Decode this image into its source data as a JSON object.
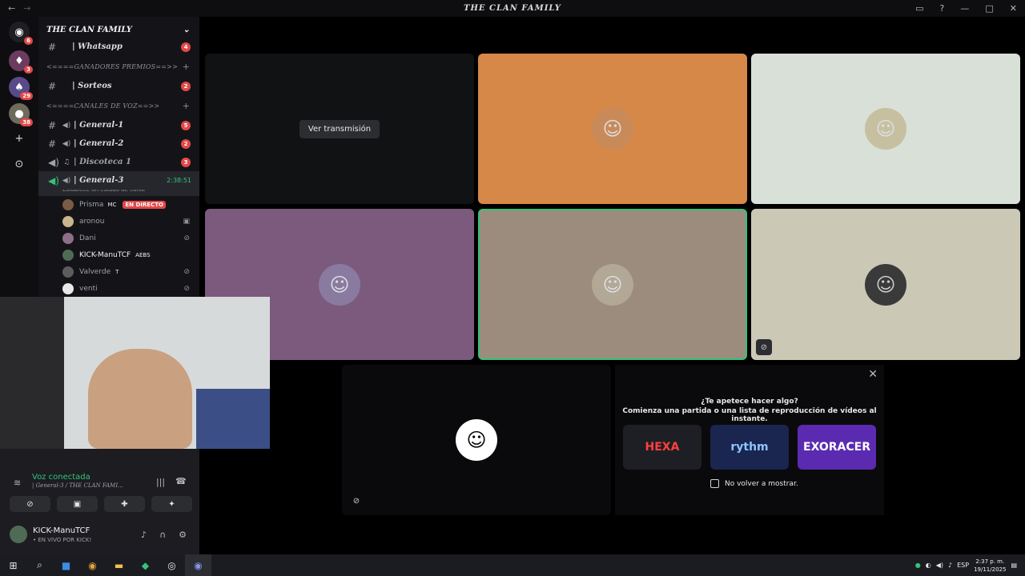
{
  "window": {
    "title": "THE CLAN FAMILY"
  },
  "server": {
    "name": "THE CLAN FAMILY"
  },
  "rail": {
    "dm_badge": "6",
    "s1_badge": "3",
    "s2_badge": "29",
    "s3_badge": "38"
  },
  "channels": [
    {
      "name": "| Whatsapp",
      "count": "4"
    },
    {
      "category": "<====GANADORES PREMIOS==>>"
    },
    {
      "name": "| Sorteos",
      "count": "2"
    },
    {
      "category": "<====CANALES DE VOZ==>>"
    },
    {
      "name": "| General-1",
      "count": "5"
    },
    {
      "name": "| General-2",
      "count": "2"
    },
    {
      "name": "| Discoteca 1",
      "count": "3"
    },
    {
      "name": "| General-3",
      "time": "2:38:51"
    }
  ],
  "channel_status": "Establece un estado de canal",
  "voice_users": [
    {
      "name": "Prisma",
      "tag": "MC",
      "live": "EN DIRECTO"
    },
    {
      "name": "aronou"
    },
    {
      "name": "Dani"
    },
    {
      "name": "KICK-ManuTCF",
      "tag": "AEBS"
    },
    {
      "name": "Valverde",
      "tag": "T"
    },
    {
      "name": "venti"
    }
  ],
  "stream": {
    "watch_label": "Ver transmisión"
  },
  "activity": {
    "title": "¿Te apetece hacer algo?",
    "subtitle": "Comienza una partida o una lista de reproducción de vídeos al instante.",
    "games": [
      "HEXA",
      "rythm",
      "EXORACER"
    ],
    "dont_show": "No volver a mostrar."
  },
  "voice": {
    "status": "Voz conectada",
    "channel": "| General-3 / THE CLAN FAMI..."
  },
  "user": {
    "name": "KICK-ManuTCF",
    "status": "• EN VIVO POR KICK!"
  },
  "taskbar": {
    "lang": "ESP",
    "time": "2:37 p. m.",
    "date": "19/11/2025"
  },
  "colors": {
    "accent_green": "#35c27a",
    "badge_red": "#e34848"
  }
}
